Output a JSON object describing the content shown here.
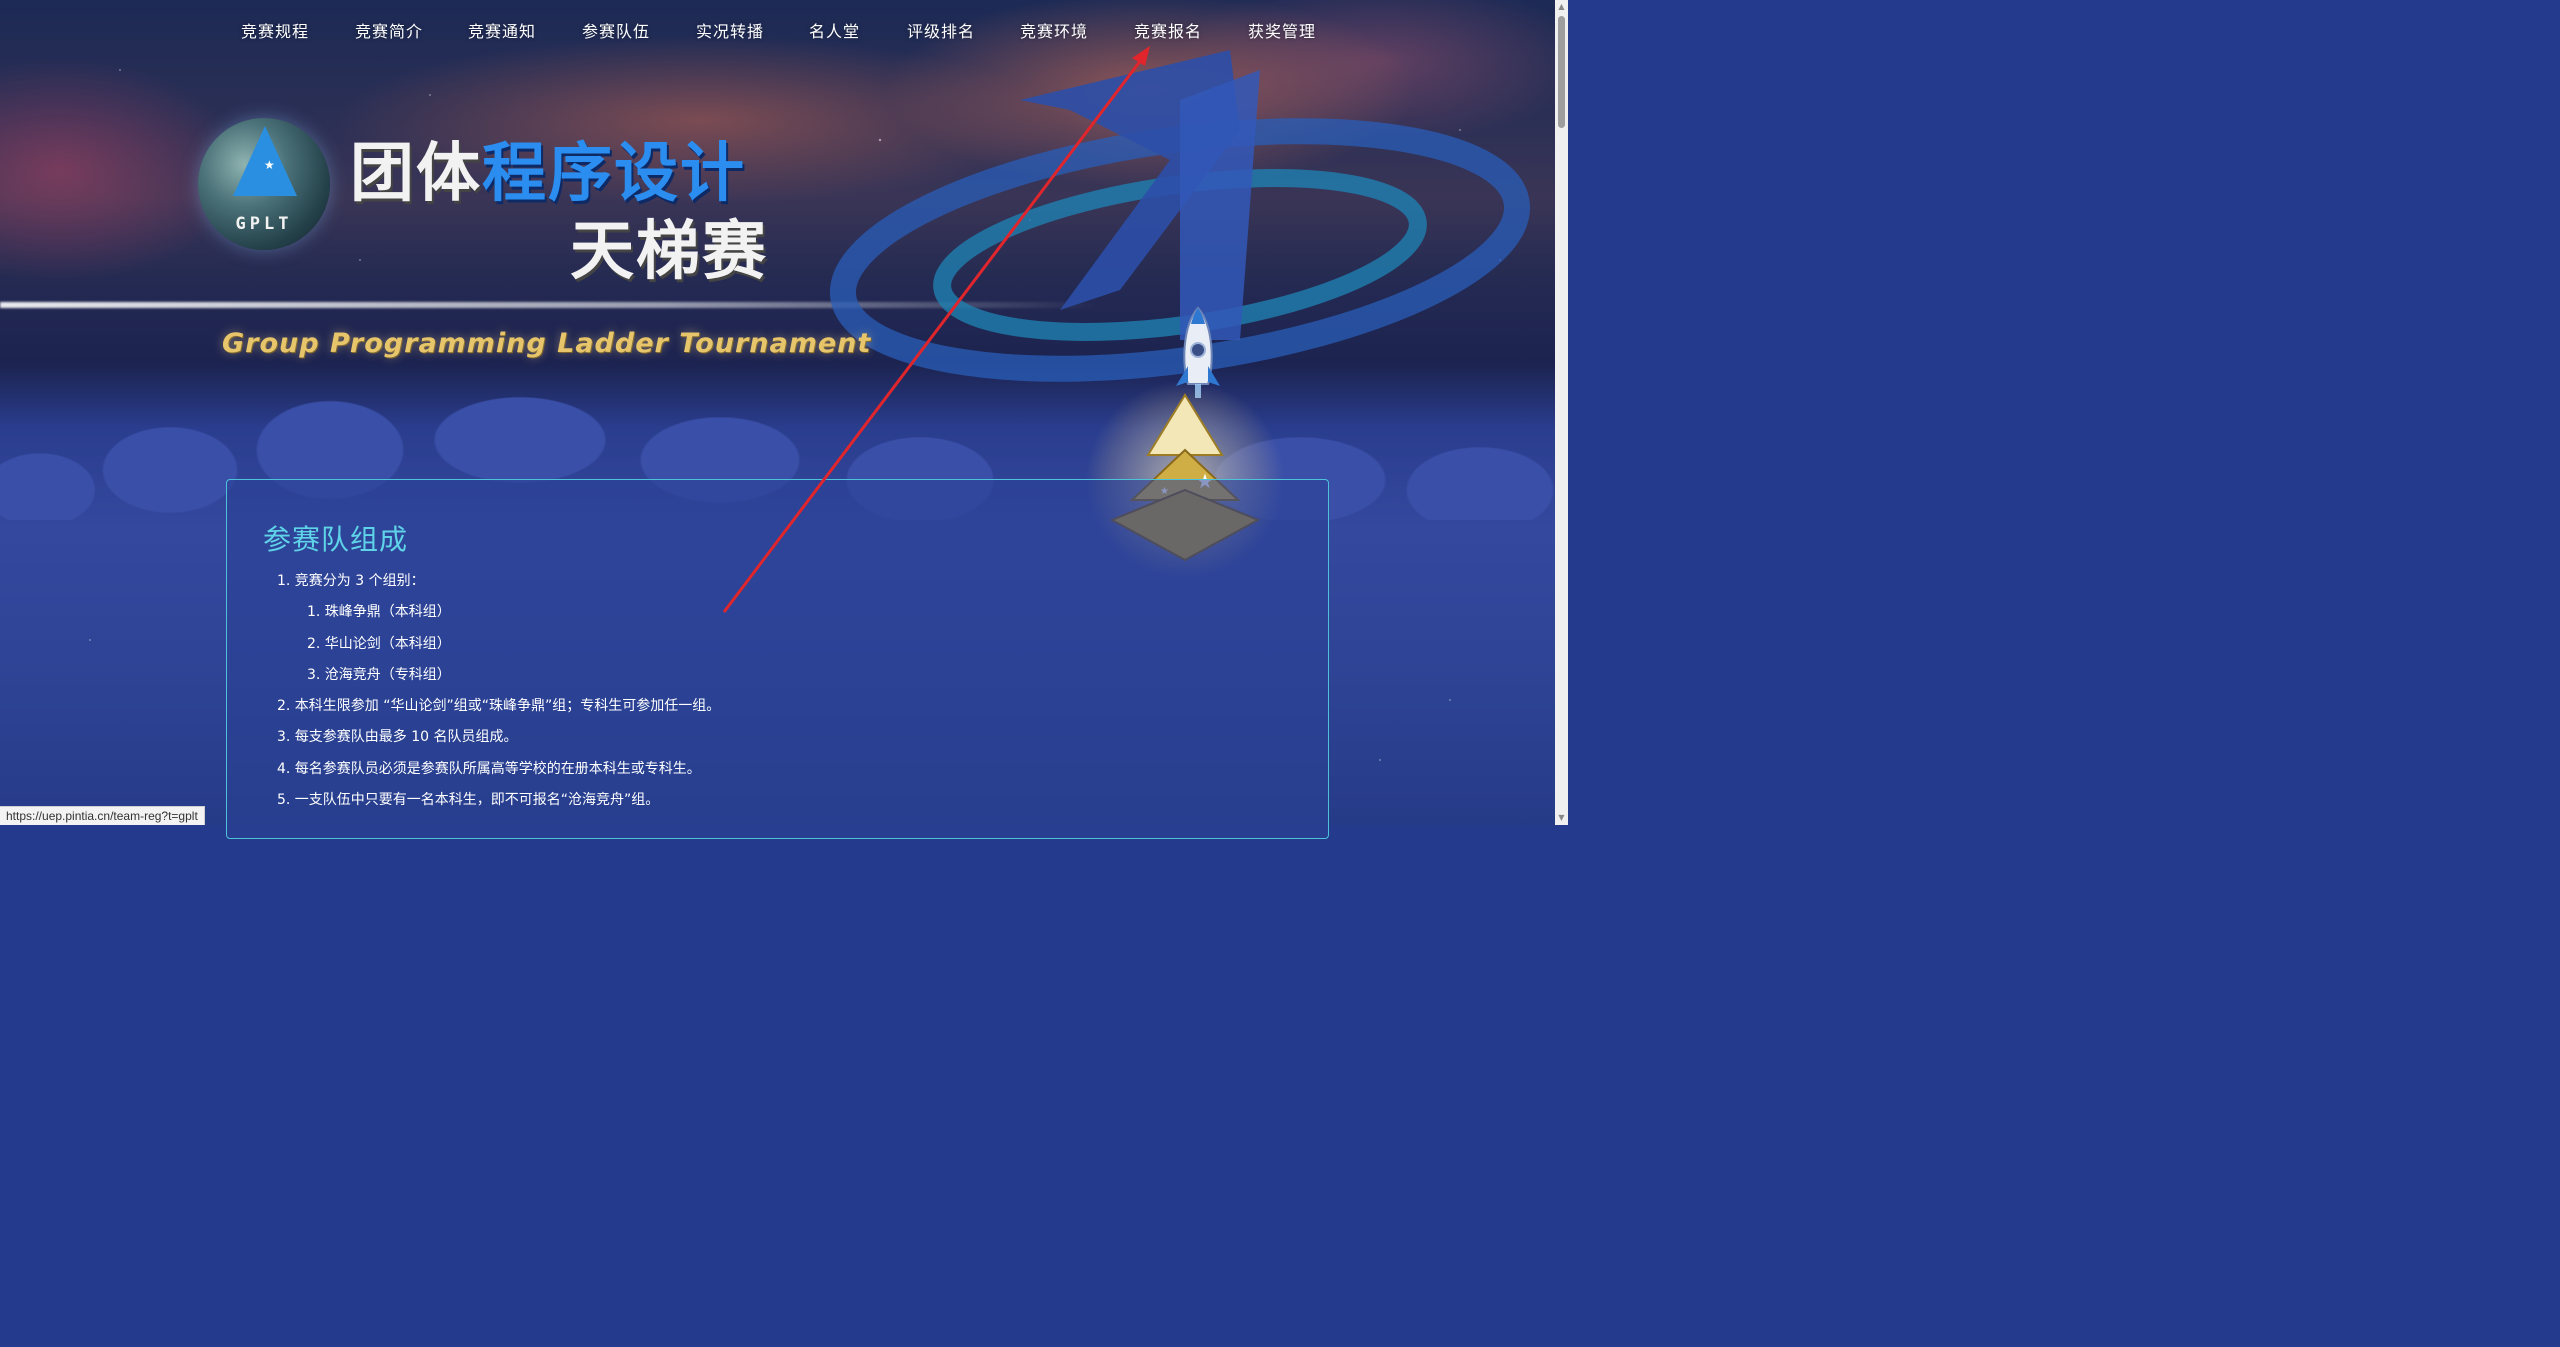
{
  "nav": {
    "items": [
      {
        "label": "竞赛规程",
        "active": true
      },
      {
        "label": "竞赛简介"
      },
      {
        "label": "竞赛通知"
      },
      {
        "label": "参赛队伍"
      },
      {
        "label": "实况转播"
      },
      {
        "label": "名人堂"
      },
      {
        "label": "评级排名"
      },
      {
        "label": "竞赛环境"
      },
      {
        "label": "竞赛报名"
      },
      {
        "label": "获奖管理"
      }
    ]
  },
  "banner": {
    "logo_text": "GPLT",
    "title_white_1": "团体",
    "title_blue": "程序设计",
    "title_line2": "天梯赛",
    "subtitle": "Group Programming Ladder Tournament"
  },
  "section": {
    "heading": "参赛队组成",
    "items": [
      {
        "level": 1,
        "text": "1. 竞赛分为 3 个组别："
      },
      {
        "level": 2,
        "text": "1. 珠峰争鼎（本科组）"
      },
      {
        "level": 2,
        "text": "2. 华山论剑（本科组）"
      },
      {
        "level": 2,
        "text": "3. 沧海竞舟（专科组）"
      },
      {
        "level": 1,
        "text": "2. 本科生限参加 “华山论剑”组或“珠峰争鼎”组；专科生可参加任一组。"
      },
      {
        "level": 1,
        "text": "3. 每支参赛队由最多 10 名队员组成。"
      },
      {
        "level": 1,
        "text": "4. 每名参赛队员必须是参赛队所属高等学校的在册本科生或专科生。"
      },
      {
        "level": 1,
        "text": "5. 一支队伍中只要有一名本科生，即不可报名“沧海竞舟”组。"
      }
    ]
  },
  "statusbar": {
    "url": "https://uep.pintia.cn/team-reg?t=gplt"
  },
  "colors": {
    "heading": "#5fd3e8",
    "panel_border": "#4cc3d9",
    "title_blue": "#2b8df0",
    "subtitle_gold": "#e7c56a",
    "arrow": "#e0262c"
  }
}
